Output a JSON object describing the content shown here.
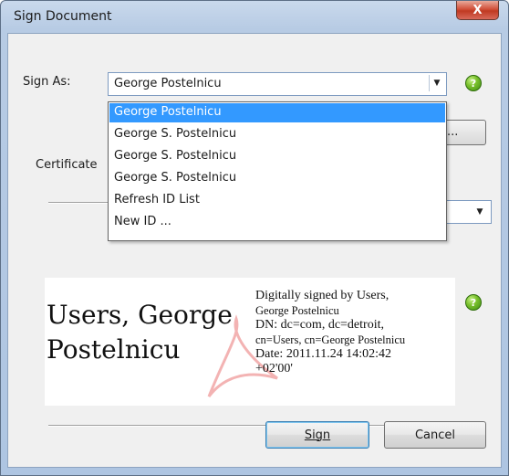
{
  "window": {
    "title": "Sign Document",
    "close_glyph": "X"
  },
  "sign_as": {
    "label": "Sign As:",
    "selected": "George Postelnicu",
    "help_icon": "help-icon"
  },
  "certificate": {
    "label": "Certificate",
    "browse_label": "..."
  },
  "dropdown": {
    "items": [
      {
        "label": "George Postelnicu",
        "selected": true
      },
      {
        "label": "George S. Postelnicu",
        "selected": false
      },
      {
        "label": "George S. Postelnicu",
        "selected": false
      },
      {
        "label": "George S. Postelnicu",
        "selected": false
      },
      {
        "label": "Refresh ID List",
        "selected": false
      },
      {
        "label": "New ID ...",
        "selected": false
      }
    ]
  },
  "preview": {
    "name_line1": "Users, George",
    "name_line2": "Postelnicu",
    "details": [
      "Digitally signed by Users,",
      "George Postelnicu",
      "DN: dc=com, dc=detroit,",
      "cn=Users, cn=George Postelnicu",
      "Date: 2011.11.24 14:02:42",
      "+02'00'"
    ]
  },
  "buttons": {
    "sign": "Sign",
    "cancel": "Cancel"
  },
  "colors": {
    "selection": "#3399ff",
    "help_green": "#7cc22e",
    "close_red": "#c03a22"
  }
}
